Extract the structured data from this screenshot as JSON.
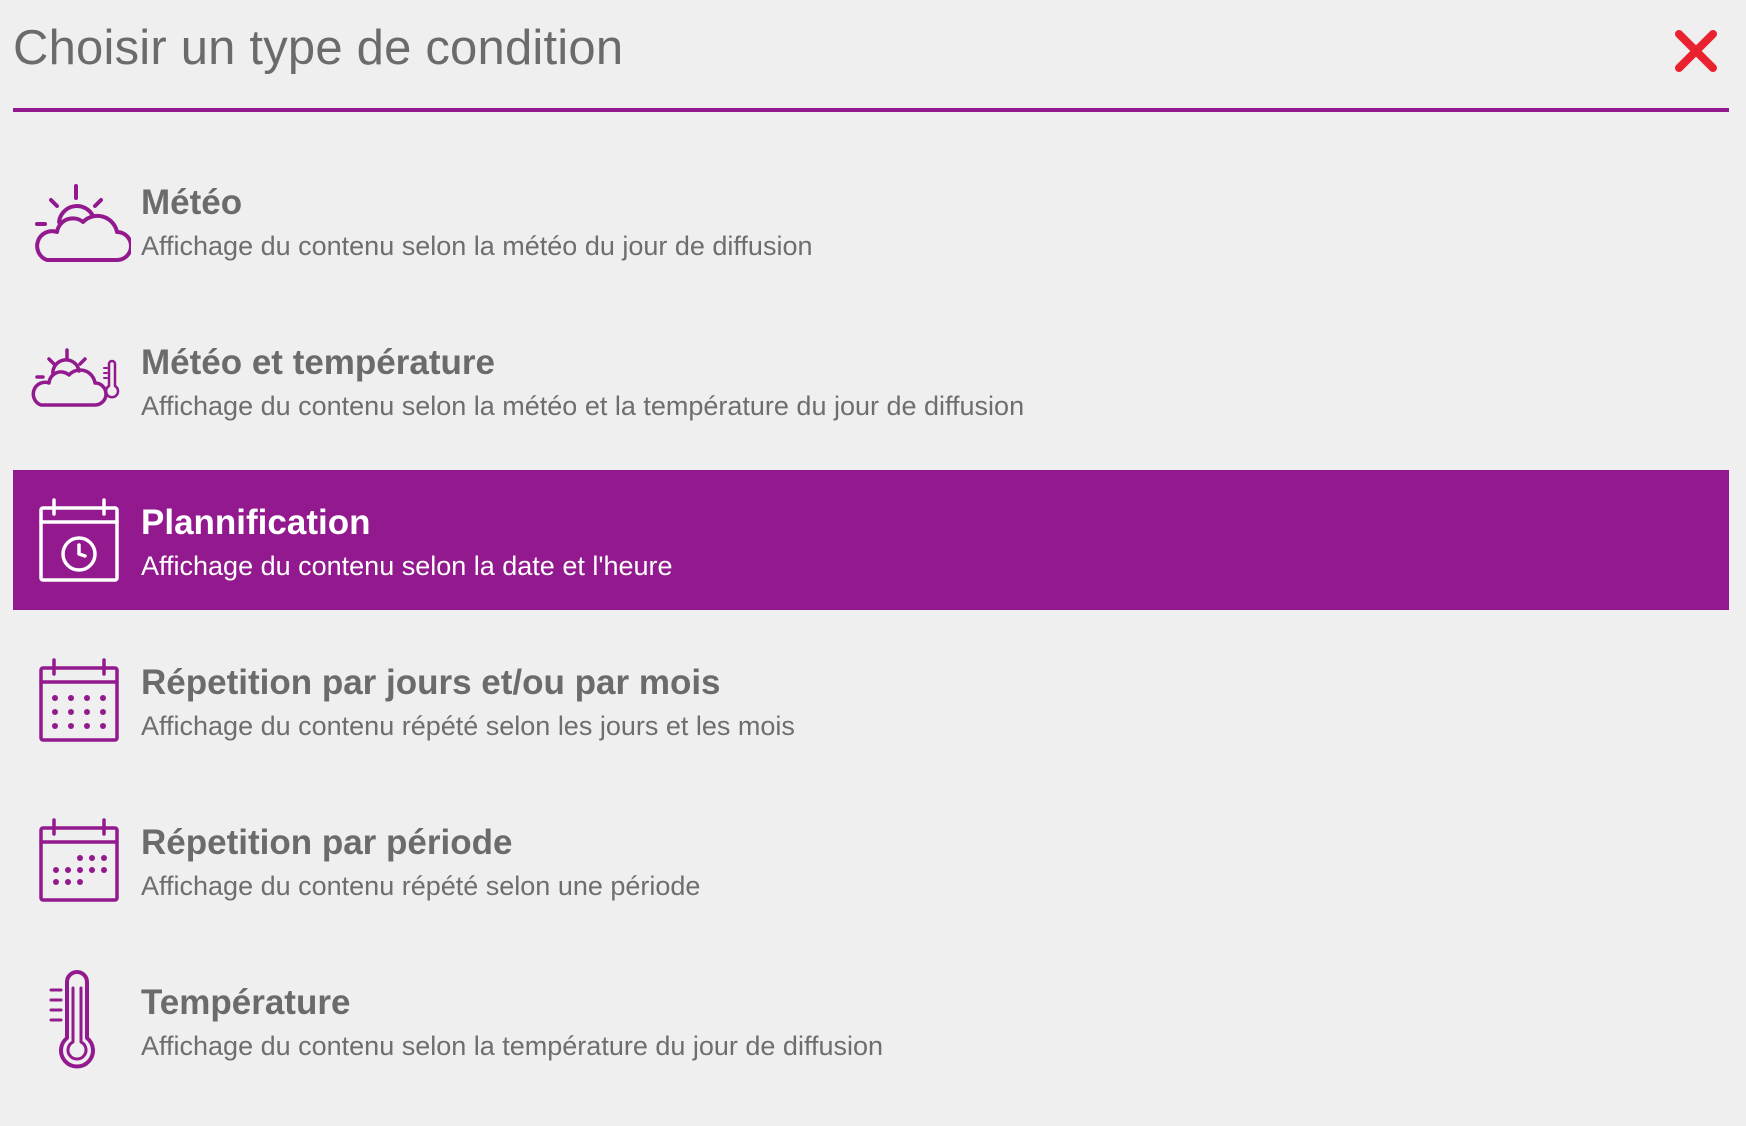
{
  "dialog": {
    "title": "Choisir un type de condition",
    "close_icon": "close-icon"
  },
  "colors": {
    "accent": "#921a8e",
    "close": "#e8232f",
    "text": "#6b6b6b",
    "background": "#efefef"
  },
  "conditions": [
    {
      "label": "Météo",
      "description": "Affichage du contenu selon la météo du jour de diffusion",
      "icon": "weather-icon",
      "selected": false
    },
    {
      "label": "Météo et température",
      "description": "Affichage du contenu selon la météo et la température du jour de diffusion",
      "icon": "weather-temperature-icon",
      "selected": false
    },
    {
      "label": "Plannification",
      "description": "Affichage du contenu selon la date et l'heure",
      "icon": "calendar-clock-icon",
      "selected": true
    },
    {
      "label": "Répetition par jours et/ou par mois",
      "description": "Affichage du contenu répété selon les jours et les mois",
      "icon": "calendar-grid-icon",
      "selected": false
    },
    {
      "label": "Répetition par période",
      "description": "Affichage du contenu répété selon une période",
      "icon": "calendar-period-icon",
      "selected": false
    },
    {
      "label": "Température",
      "description": "Affichage du contenu selon la température du jour de diffusion",
      "icon": "thermometer-icon",
      "selected": false
    }
  ]
}
